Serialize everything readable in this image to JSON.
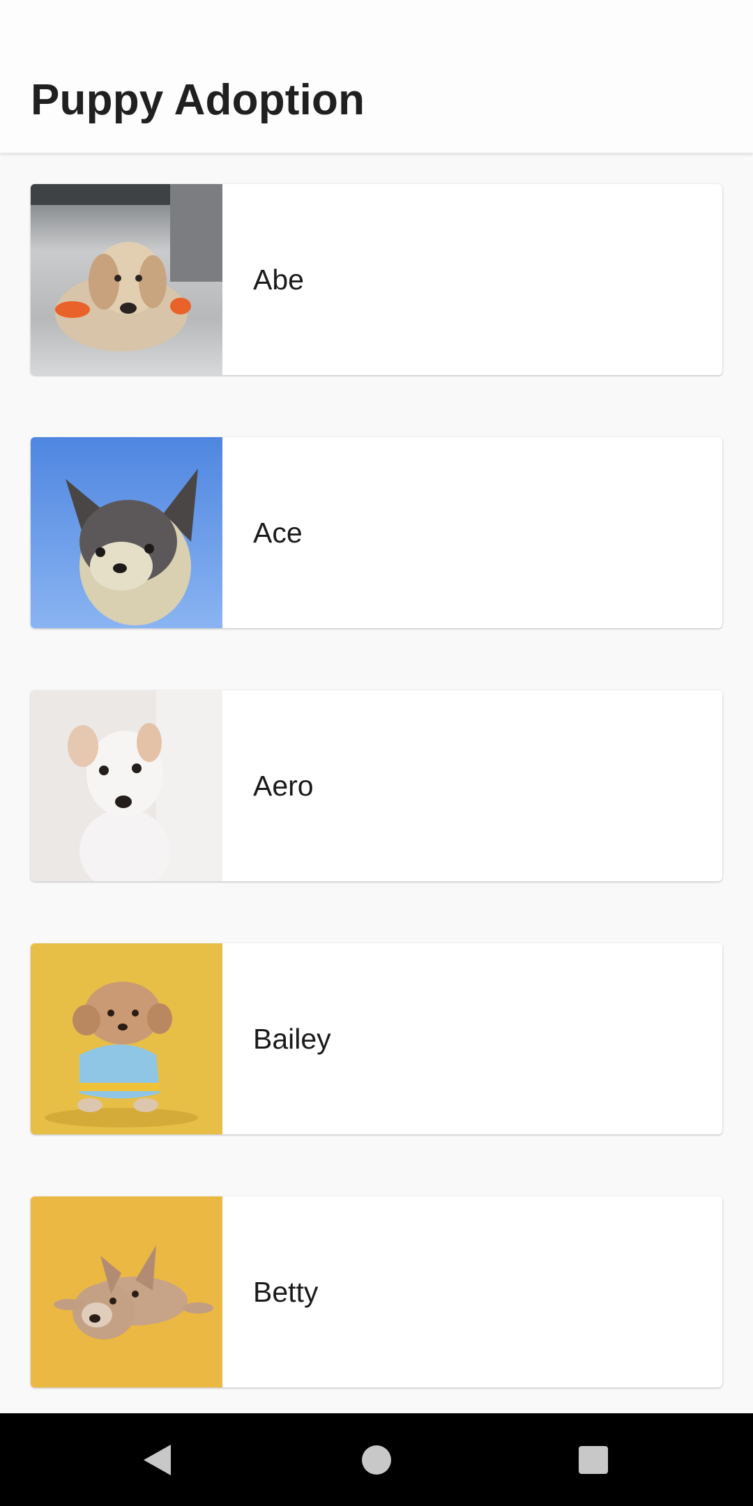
{
  "app_bar": {
    "title": "Puppy Adoption"
  },
  "puppies": [
    {
      "name": "Abe",
      "photo": "cream poodle puppy lying on floor with orange toy"
    },
    {
      "name": "Ace",
      "photo": "chihuahua puppy against blue sky"
    },
    {
      "name": "Aero",
      "photo": "white terrier puppy on light background"
    },
    {
      "name": "Bailey",
      "photo": "small fluffy puppy in blue shirt on yellow background"
    },
    {
      "name": "Betty",
      "photo": "french bulldog puppy lying on yellow background"
    }
  ],
  "nav": {
    "back_icon": "back-triangle-icon",
    "home_icon": "home-circle-icon",
    "recents_icon": "recents-square-icon"
  },
  "colors": {
    "app_bar": "#fdfdfd",
    "background": "#f9f9f9",
    "card": "#ffffff",
    "nav_bar": "#000000"
  }
}
